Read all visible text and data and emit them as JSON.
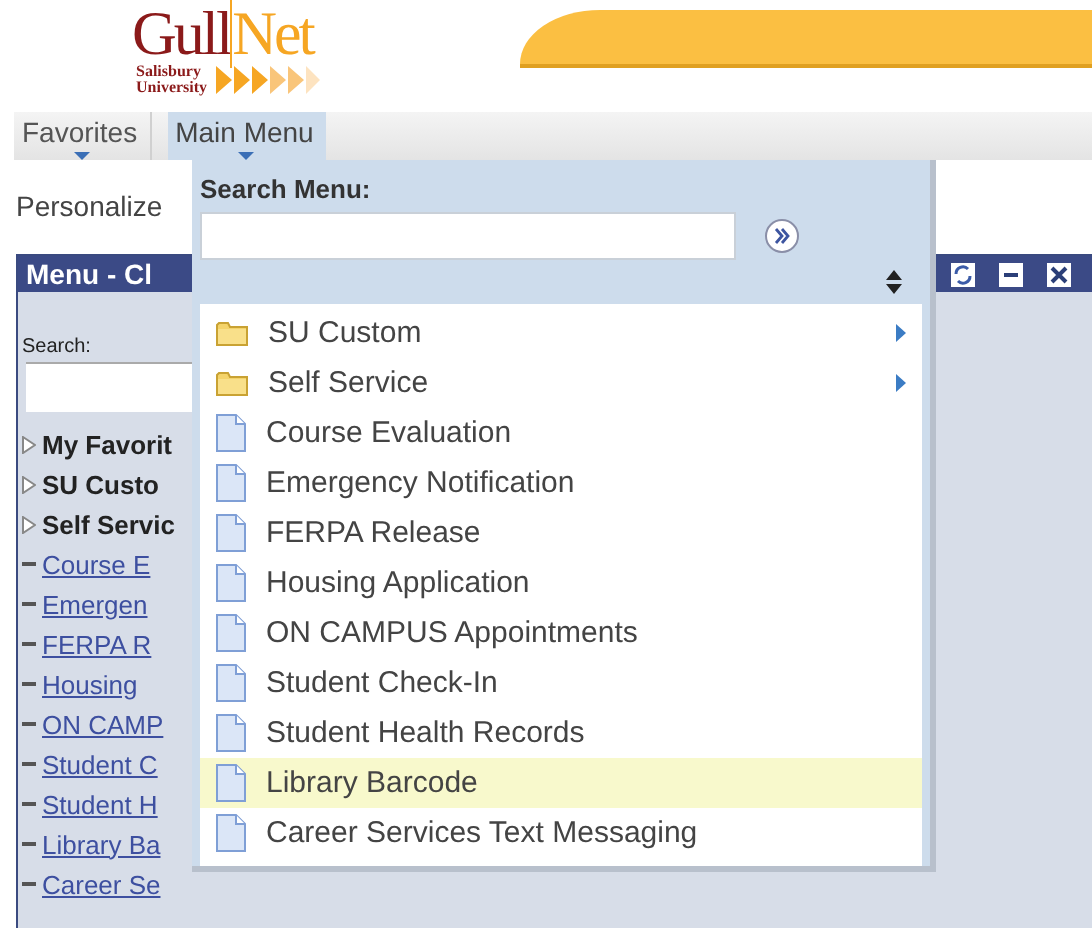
{
  "logo": {
    "word_1": "Gull",
    "word_2": "Net",
    "subtitle_1": "Salisbury",
    "subtitle_2": "University"
  },
  "nav": [
    {
      "label": "Favorites",
      "selected": false
    },
    {
      "label": "Main Menu",
      "selected": true
    }
  ],
  "personalize": "Personalize",
  "panel": {
    "title": "Menu - Cl",
    "search_label": "Search:",
    "tree": [
      {
        "label": "My Favorit",
        "kind": "folder"
      },
      {
        "label": "SU Custo",
        "kind": "folder"
      },
      {
        "label": "Self Servic",
        "kind": "folder"
      },
      {
        "label": "Course E",
        "kind": "link"
      },
      {
        "label": "Emergen",
        "kind": "link"
      },
      {
        "label": "FERPA R",
        "kind": "link"
      },
      {
        "label": "Housing",
        "kind": "link"
      },
      {
        "label": "ON CAMP",
        "kind": "link"
      },
      {
        "label": "Student C",
        "kind": "link"
      },
      {
        "label": "Student H",
        "kind": "link"
      },
      {
        "label": "Library Ba",
        "kind": "link"
      },
      {
        "label": "Career Se",
        "kind": "link"
      }
    ]
  },
  "dropdown": {
    "search_label": "Search Menu:",
    "items": [
      {
        "label": "SU Custom",
        "kind": "folder",
        "selected": false
      },
      {
        "label": "Self Service",
        "kind": "folder",
        "selected": false
      },
      {
        "label": "Course Evaluation",
        "kind": "page",
        "selected": false
      },
      {
        "label": "Emergency Notification",
        "kind": "page",
        "selected": false
      },
      {
        "label": "FERPA Release",
        "kind": "page",
        "selected": false
      },
      {
        "label": "Housing Application",
        "kind": "page",
        "selected": false
      },
      {
        "label": "ON CAMPUS Appointments",
        "kind": "page",
        "selected": false
      },
      {
        "label": "Student Check-In",
        "kind": "page",
        "selected": false
      },
      {
        "label": "Student Health Records",
        "kind": "page",
        "selected": false
      },
      {
        "label": "Library Barcode",
        "kind": "page",
        "selected": true
      },
      {
        "label": "Career Services Text Messaging",
        "kind": "page",
        "selected": false
      }
    ]
  }
}
